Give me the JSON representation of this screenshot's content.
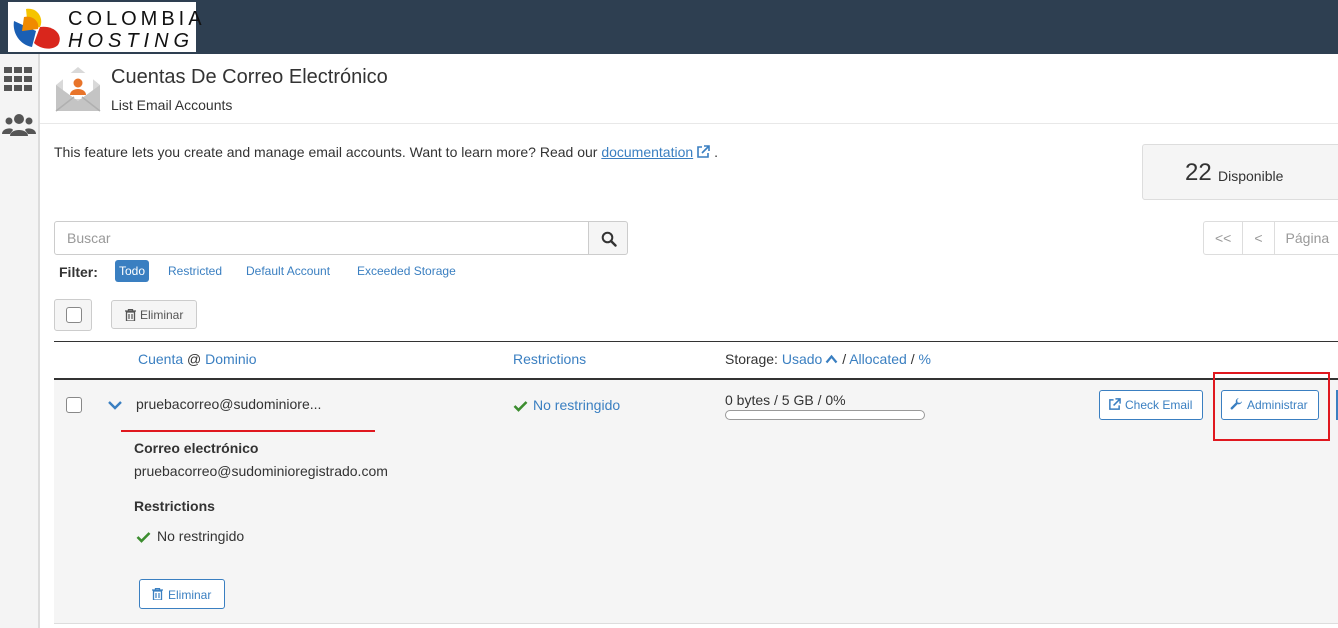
{
  "brand": {
    "line1": "COLOMBIA",
    "line2": "HOSTING"
  },
  "siderail": {
    "items": [
      {
        "icon": "apps-grid-icon"
      },
      {
        "icon": "users-icon"
      }
    ]
  },
  "header": {
    "title": "Cuentas De Correo Electrónico",
    "subtitle": "List Email Accounts"
  },
  "intro": {
    "text": "This feature lets you create and manage email accounts. Want to learn more? Read our",
    "link": "documentation",
    "trailing": "."
  },
  "available": {
    "count": "22",
    "label": "Disponible"
  },
  "search": {
    "placeholder": "Buscar"
  },
  "pagination": {
    "first": "<<",
    "prev": "<",
    "page_label": "Página"
  },
  "filter": {
    "label": "Filter:",
    "options": [
      "Todo",
      "Restricted",
      "Default Account",
      "Exceeded Storage"
    ],
    "active": "Todo"
  },
  "bulk": {
    "delete_label": "Eliminar"
  },
  "table": {
    "headers": {
      "account": "Cuenta",
      "at": "@",
      "domain": "Dominio",
      "restrictions": "Restrictions",
      "storage_prefix": "Storage:",
      "used": "Usado",
      "sep1": "/",
      "allocated": "Allocated",
      "sep2": "/",
      "percent": "%"
    },
    "rows": [
      {
        "account": "pruebacorreo@sudominiore...",
        "restriction": "No restringido",
        "storage": "0 bytes / 5 GB / 0%",
        "usage_fraction": 0,
        "check_email": "Check Email",
        "manage": "Administrar",
        "details": {
          "email_label": "Correo electrónico",
          "email_value": "pruebacorreo@sudominioregistrado.com",
          "restrictions_label": "Restrictions",
          "restrictions_value": "No restringido",
          "delete_label": "Eliminar"
        }
      }
    ]
  },
  "colors": {
    "topbar": "#2e3f51",
    "link": "#3a7fc1",
    "highlight": "#e0181f",
    "check": "#3c8d2f"
  }
}
